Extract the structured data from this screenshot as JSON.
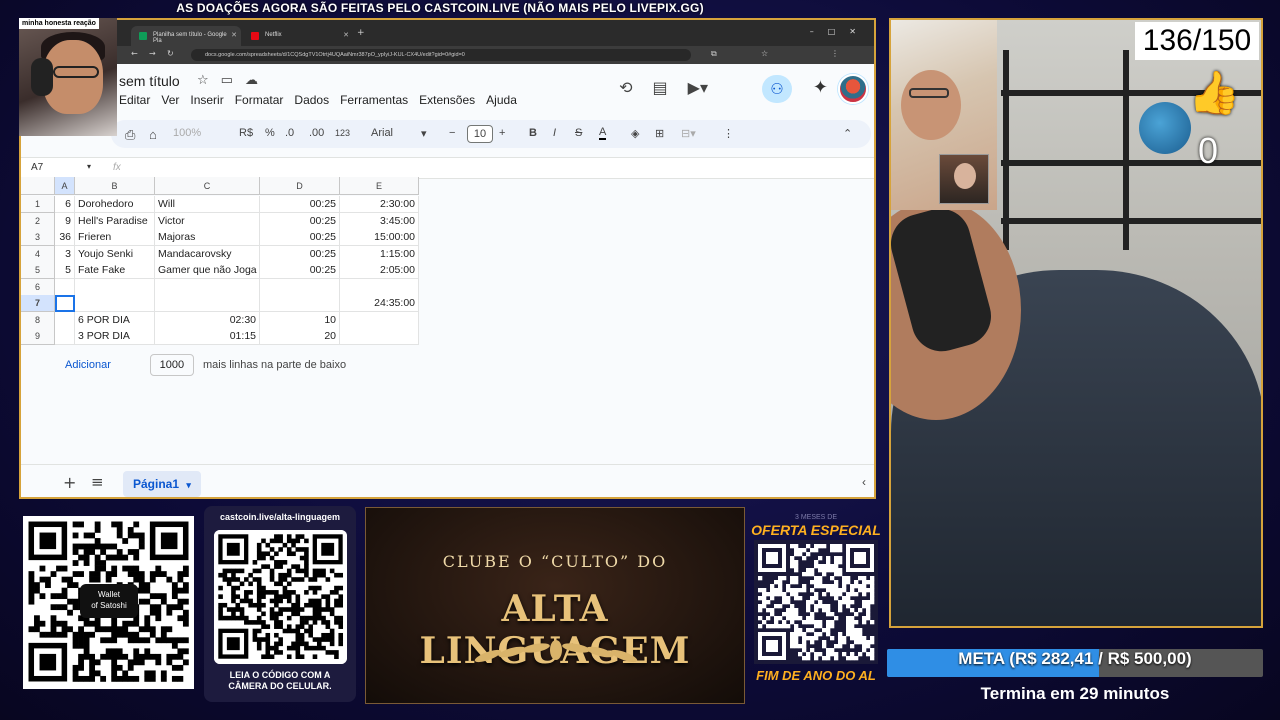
{
  "banner": "AS DOAÇÕES AGORA SÃO FEITAS PELO CASTCOIN.LIVE (NÃO MAIS PELO LIVEPIX.GG)",
  "facecam_label": "minha honesta reação",
  "browser": {
    "tabs": [
      {
        "label": "Planilha sem título - Google Pla",
        "active": true,
        "color": "#0f9d58"
      },
      {
        "label": "Netflix",
        "active": false,
        "color": "#e50914"
      }
    ],
    "url": "docs.google.com/spreadsheets/d/1CQSdgTV1Otrtj4UQAaiNmr387pO_ypIyiJ-KUL-CX4U/edit?gid=0#gid=0"
  },
  "sheets": {
    "title": "sem título",
    "menu": [
      "Editar",
      "Ver",
      "Inserir",
      "Formatar",
      "Dados",
      "Ferramentas",
      "Extensões",
      "Ajuda"
    ],
    "toolbar": {
      "zoom": "100%",
      "currency": "R$",
      "percent": "%",
      "dec_less": ".0",
      "dec_more": ".00",
      "number_format": "123",
      "font": "Arial",
      "font_size": "10"
    },
    "name_box": "A7",
    "fx": "fx",
    "columns": [
      "A",
      "B",
      "C",
      "D",
      "E"
    ],
    "rows": [
      {
        "n": "1",
        "a": "6",
        "b": "Dorohedoro",
        "c": "Will",
        "d": "00:25",
        "e": "2:30:00"
      },
      {
        "n": "2",
        "a": "9",
        "b": "Hell's Paradise",
        "c": "Victor",
        "d": "00:25",
        "e": "3:45:00"
      },
      {
        "n": "3",
        "a": "36",
        "b": "Frieren",
        "c": "Majoras",
        "d": "00:25",
        "e": "15:00:00"
      },
      {
        "n": "4",
        "a": "3",
        "b": "Youjo Senki",
        "c": "Mandacarovsky",
        "d": "00:25",
        "e": "1:15:00"
      },
      {
        "n": "5",
        "a": "5",
        "b": "Fate Fake",
        "c": "Gamer que não Joga",
        "d": "00:25",
        "e": "2:05:00"
      },
      {
        "n": "6",
        "a": "",
        "b": "",
        "c": "",
        "d": "",
        "e": ""
      },
      {
        "n": "7",
        "a": "",
        "b": "",
        "c": "",
        "d": "",
        "e": "24:35:00"
      },
      {
        "n": "8",
        "a": "",
        "b": "6 POR DIA",
        "c": "02:30",
        "d": "10",
        "e": ""
      },
      {
        "n": "9",
        "a": "",
        "b": "3 POR DIA",
        "c": "01:15",
        "d": "20",
        "e": ""
      }
    ],
    "add_rows": {
      "button": "Adicionar",
      "value": "1000",
      "suffix": "mais linhas na parte de baixo"
    },
    "sheet_tab": "Página1"
  },
  "overlay": {
    "counter": "136/150",
    "likes": "0",
    "goal_text": "META (R$ 282,41 / R$ 500,00)",
    "goal_progress": 0.565,
    "ends_text": "Termina em 29 minutos",
    "wallet_label_1": "Wallet",
    "wallet_label_2": "of Satoshi",
    "card2_top": "castcoin.live/alta-linguagem",
    "card2_bottom_1": "LEIA O CÓDIGO COM A",
    "card2_bottom_2": "CÂMERA DO CELULAR.",
    "club_line1": "CLUBE O “CULTO” DO",
    "club_line2": "ALTA LINGUAGEM",
    "offer_sub": "3 MESES DE",
    "offer_top": "OFERTA ESPECIAL",
    "offer_bottom": "FIM DE ANO DO AL"
  },
  "colors": {
    "border_gold": "#d6a33b",
    "goal_fill": "#2f8ee5",
    "offer_orange": "#ffb020",
    "club_gold": "#e8c27a"
  }
}
